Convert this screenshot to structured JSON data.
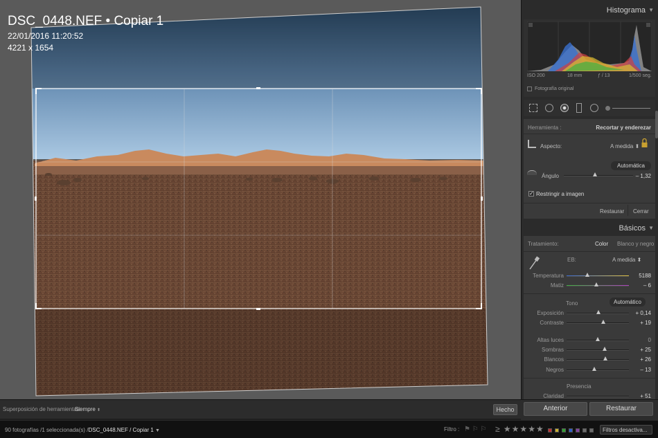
{
  "photo": {
    "title": "DSC_0448.NEF • Copiar 1",
    "datetime": "22/01/2016 11:20:52",
    "dimensions": "4221 x 1654"
  },
  "toolbar": {
    "overlay_label": "Superposición de herramientas:",
    "overlay_value": "Siempre",
    "done_label": "Hecho"
  },
  "filmstrip": {
    "count_text": "90 fotografías /1 seleccionada(s) /",
    "current_path": "DSC_0448.NEF / Copiar 1",
    "filter_label": "Filtro :",
    "stars": "≥ ★★★★★",
    "filters_off": "Filtros desactiva...",
    "swatch_colors": [
      "#c03030",
      "#c8b030",
      "#30a030",
      "#3060c8",
      "#8040a0",
      "#6a6a6a",
      "#6a6a6a"
    ]
  },
  "histogram": {
    "header": "Histograma",
    "iso": "ISO 200",
    "focal": "18 mm",
    "aperture": "ƒ / 13",
    "shutter": "1/500 seg.",
    "original_photo": "Fotografía original"
  },
  "crop": {
    "tool_label": "Herramienta :",
    "tool_value": "Recortar y enderezar",
    "aspect_label": "Aspecto:",
    "aspect_value": "A medida",
    "auto_label": "Automática",
    "angle_label": "Ángulo",
    "angle_value": "– 1,32",
    "angle_fraction": 0.55,
    "constrain_label": "Restringir a imagen",
    "reset_label": "Restaurar",
    "close_label": "Cerrar"
  },
  "basic": {
    "header": "Básicos",
    "treatment_label": "Tratamiento:",
    "treatment_color": "Color",
    "treatment_bw": "Blanco y negro",
    "wb_label": "EB:",
    "wb_value": "A medida",
    "temp_label": "Temperatura",
    "temp_value": "5188",
    "tint_label": "Matiz",
    "tint_value": "– 6",
    "tone_label": "Tono",
    "tone_auto": "Automático",
    "exposure_label": "Exposición",
    "exposure_value": "+ 0,14",
    "contrast_label": "Contraste",
    "contrast_value": "+ 19",
    "highlights_label": "Altas luces",
    "highlights_value": "0",
    "shadows_label": "Sombras",
    "shadows_value": "+ 25",
    "whites_label": "Blancos",
    "whites_value": "+ 26",
    "blacks_label": "Negros",
    "blacks_value": "– 13",
    "presence_label": "Presencia",
    "clarity_label": "Claridad",
    "clarity_value": "+ 51"
  },
  "bottom": {
    "previous": "Anterior",
    "reset": "Restaurar"
  }
}
